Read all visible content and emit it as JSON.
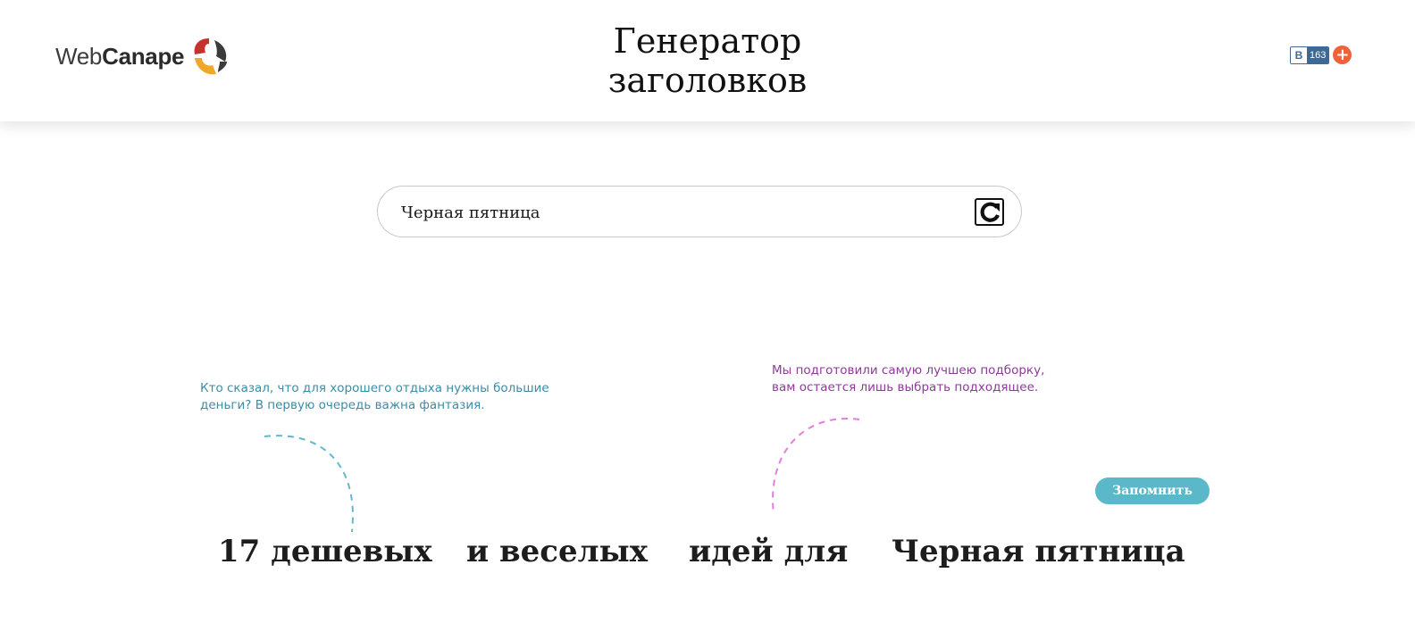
{
  "header": {
    "logo": {
      "text_regular": "Web",
      "text_bold": "Canape"
    },
    "title_line1": "Генератор",
    "title_line2": "заголовков",
    "share": {
      "vk_letter": "В",
      "vk_count": "163",
      "plus": "+"
    }
  },
  "search": {
    "value": "Черная пятница",
    "refresh_icon": "refresh-icon"
  },
  "hints": {
    "left": "Кто сказал, что для хорошего отдыха нужны большие деньги? В первую очередь важна фантазия.",
    "right": "Мы подготовили самую лучшею подборку, вам остается лишь выбрать подходящее."
  },
  "remember_button": "Запомнить",
  "headline": {
    "parts": [
      "17 дешевых",
      "и веселых",
      "идей для",
      "Черная пятница"
    ]
  },
  "colors": {
    "hint_left": "#3b8ca6",
    "hint_right": "#8e3a98",
    "button": "#5bb8c8",
    "vk": "#3e6896",
    "plus": "#f0603a"
  }
}
